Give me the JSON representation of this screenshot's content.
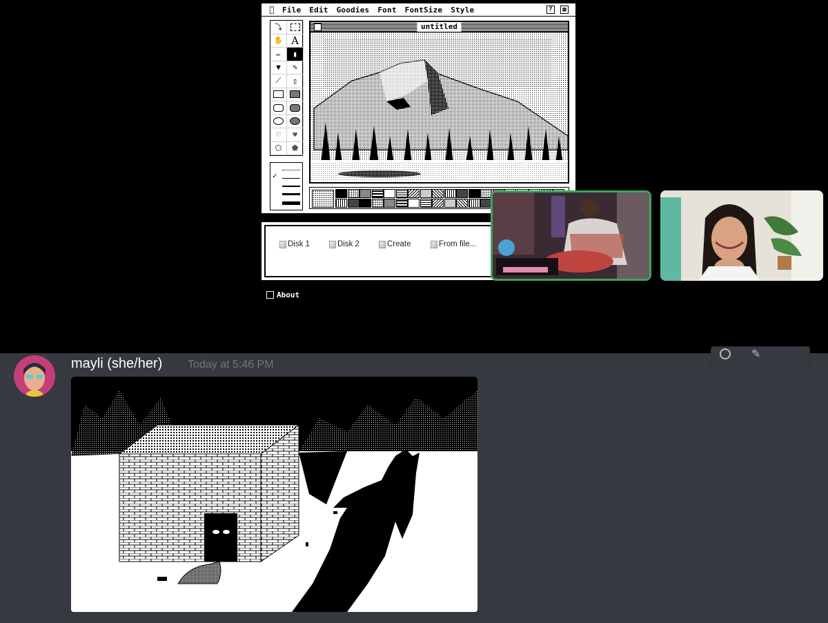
{
  "macpaint": {
    "menu": [
      "File",
      "Edit",
      "Goodies",
      "Font",
      "FontSize",
      "Style"
    ],
    "apple_icon": "apple-icon",
    "doc_title": "untitled"
  },
  "disk_bar": {
    "buttons": [
      "Disk 1",
      "Disk 2",
      "Create",
      "From file..."
    ]
  },
  "about_label": "About",
  "chat": {
    "username": "mayli (she/her)",
    "timestamp": "Today at 5:46 PM"
  },
  "colors": {
    "chat_bg": "#36393f",
    "speaking_border": "#3ba55c",
    "timestamp": "#72767d"
  }
}
